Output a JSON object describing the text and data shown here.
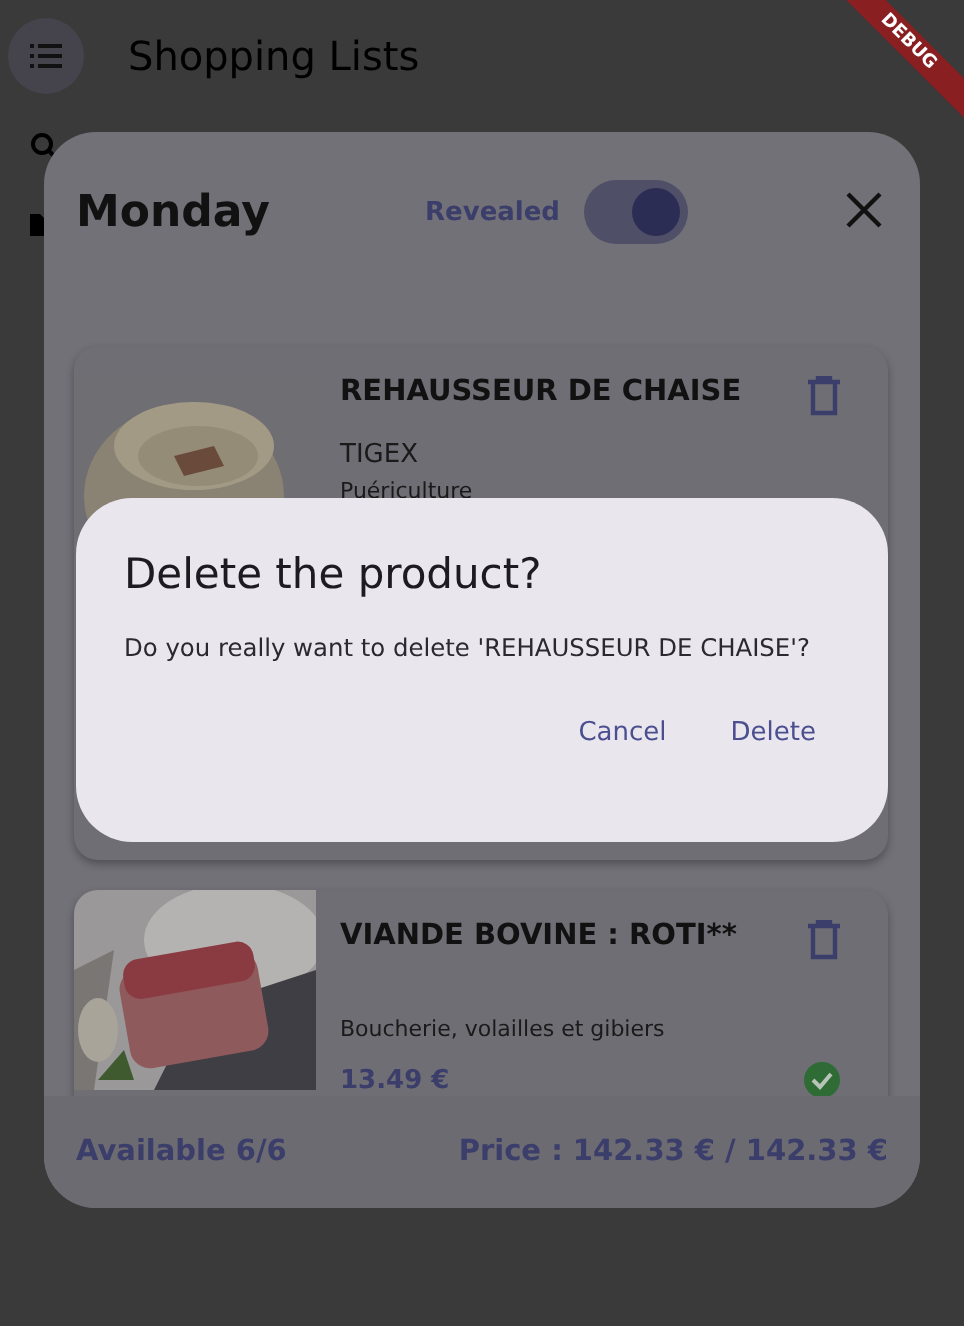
{
  "app_bar": {
    "title": "Shopping Lists"
  },
  "sheet": {
    "title": "Monday",
    "toggle": {
      "label": "Revealed",
      "on": true
    },
    "products": [
      {
        "name": "REHAUSSEUR DE CHAISE",
        "brand": "TIGEX",
        "category": "Puériculture"
      },
      {
        "name": "VIANDE BOVINE : ROTI**",
        "category": "Boucherie, volailles et gibiers",
        "price": "13.49 €",
        "available": true
      }
    ],
    "footer": {
      "available": "Available 6/6",
      "price": "Price : 142.33 € / 142.33 €"
    }
  },
  "dialog": {
    "title": "Delete the product?",
    "message": "Do you really want to delete 'REHAUSSEUR DE CHAISE'?",
    "buttons": [
      "Cancel",
      "Delete"
    ]
  },
  "debug_banner": "DEBUG"
}
